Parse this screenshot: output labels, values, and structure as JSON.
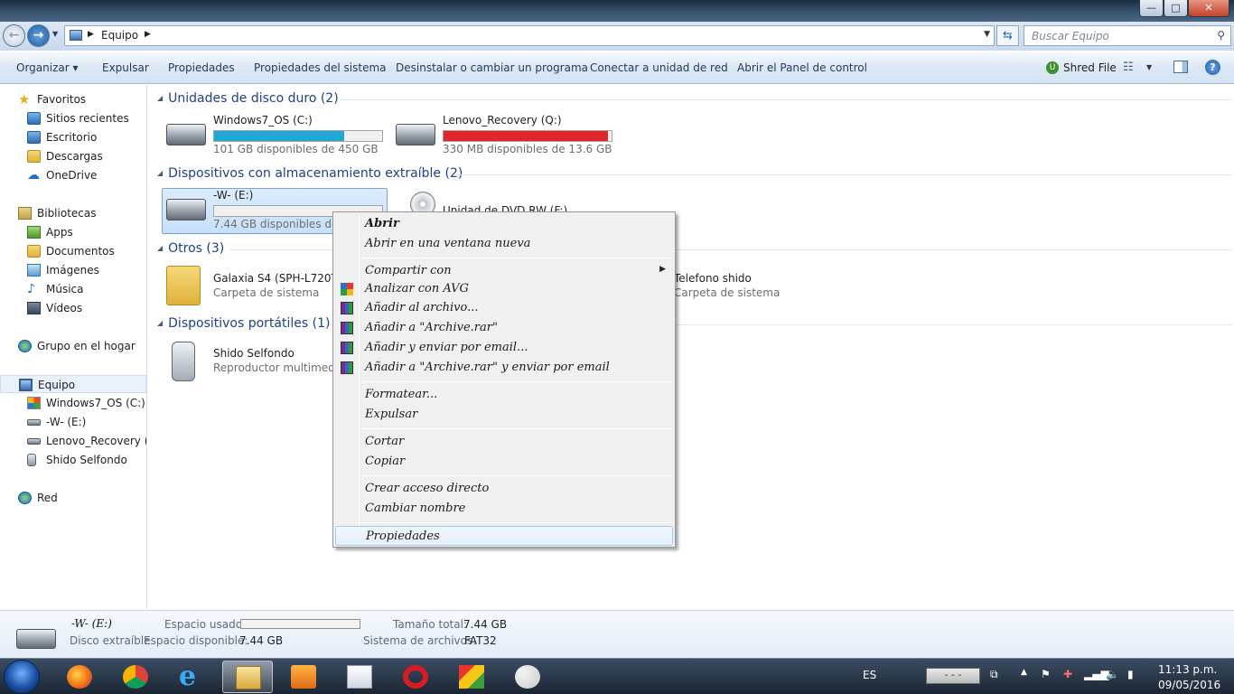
{
  "window": {
    "min": "—",
    "max": "□",
    "close": "✕"
  },
  "address": {
    "path": "Equipo",
    "search_placeholder": "Buscar Equipo"
  },
  "toolbar": {
    "organizar": "Organizar ▾",
    "expulsar": "Expulsar",
    "propiedades": "Propiedades",
    "propiedades_sistema": "Propiedades del sistema",
    "desinstalar": "Desinstalar o cambiar un programa",
    "conectar": "Conectar a unidad de red",
    "panel": "Abrir el Panel de control",
    "shred": "Shred File"
  },
  "nav": {
    "favoritos": "Favoritos",
    "sitios_recientes": "Sitios recientes",
    "escritorio": "Escritorio",
    "descargas": "Descargas",
    "onedrive": "OneDrive",
    "bibliotecas": "Bibliotecas",
    "apps": "Apps",
    "documentos": "Documentos",
    "imagenes": "Imágenes",
    "musica": "Música",
    "videos": "Vídeos",
    "grupo_hogar": "Grupo en el hogar",
    "equipo": "Equipo",
    "windows7": "Windows7_OS (C:)",
    "w_drive": "-W- (E:)",
    "lenovo": "Lenovo_Recovery (Q:",
    "shido": "Shido Selfondo",
    "red": "Red"
  },
  "groups": {
    "discos": "Unidades de disco duro (2)",
    "extraibles": "Dispositivos con almacenamiento extraíble (2)",
    "otros": "Otros (3)",
    "portatiles": "Dispositivos portátiles (1)"
  },
  "drives": {
    "c": {
      "name": "Windows7_OS (C:)",
      "free": "101 GB disponibles de 450 GB",
      "used_fraction": 0.776,
      "color": "#1fa7d6"
    },
    "q": {
      "name": "Lenovo_Recovery (Q:)",
      "free": "330 MB disponibles de 13.6 GB",
      "used_fraction": 0.976,
      "color": "#e0262a"
    },
    "e": {
      "name": "-W- (E:)",
      "free": "7.44 GB disponibles de 7.4",
      "used_fraction": 0.0
    },
    "dvd": {
      "name": "Unidad de DVD RW (F:)"
    }
  },
  "otros": {
    "galaxia": {
      "name": "Galaxia S4 (SPH-L720T)",
      "sub": "Carpeta de sistema"
    },
    "telefono": {
      "name": "Telefono shido",
      "sub": "Carpeta de sistema"
    }
  },
  "portatiles": {
    "shido": {
      "name": "Shido Selfondo",
      "sub": "Reproductor multimedia"
    }
  },
  "context_menu": {
    "abrir": "Abrir",
    "abrir_nueva": "Abrir en una ventana nueva",
    "compartir": "Compartir con",
    "avg": "Analizar con AVG",
    "anadir_archivo": "Añadir al archivo...",
    "anadir_rar": "Añadir a \"Archive.rar\"",
    "anadir_email": "Añadir y enviar por email...",
    "anadir_rar_email": "Añadir a \"Archive.rar\" y enviar por email",
    "formatear": "Formatear...",
    "expulsar": "Expulsar",
    "cortar": "Cortar",
    "copiar": "Copiar",
    "acceso_directo": "Crear acceso directo",
    "cambiar_nombre": "Cambiar nombre",
    "propiedades": "Propiedades"
  },
  "details": {
    "name": "-W- (E:)",
    "type": "Disco extraíble",
    "espacio_usado_label": "Espacio usado:",
    "espacio_disp_label": "Espacio disponible:",
    "espacio_disp": "7.44 GB",
    "tamano_label": "Tamaño total:",
    "tamano": "7.44 GB",
    "sistema_label": "Sistema de archivos:",
    "sistema": "FAT32"
  },
  "taskbar": {
    "lang": "ES",
    "tray_box": "- - -",
    "time": "11:13 p.m.",
    "date": "09/05/2016"
  }
}
